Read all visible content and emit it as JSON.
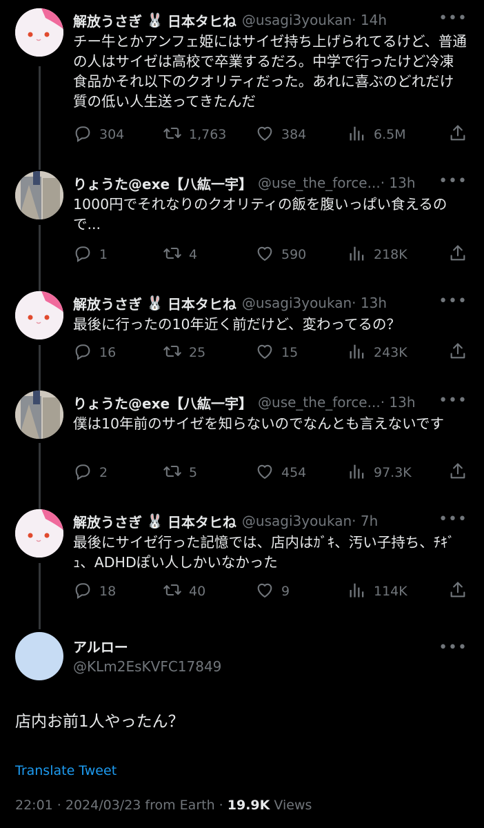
{
  "replies": [
    {
      "display_name": "解放うさぎ",
      "emoji": "🐰",
      "name_suffix": "日本タヒね",
      "handle": "@usagi3youkan",
      "time": "· 14h",
      "avatar": "rabbit",
      "text": "チー牛とかアンフェ姫にはサイゼ持ち上げられてるけど、普通の人はサイゼは高校で卒業するだろ。中学で行ったけど冷凍食品かそれ以下のクオリティだった。あれに喜ぶのどれだけ質の低い人生送ってきたんだ",
      "replies": "304",
      "retweets": "1,763",
      "likes": "384",
      "views": "6.5M"
    },
    {
      "display_name": "りょうた@exe【八紘一宇】",
      "emoji": "",
      "name_suffix": "",
      "handle": "@use_the_force...",
      "time": "· 13h",
      "avatar": "person",
      "text": "1000円でそれなりのクオリティの飯を腹いっぱい食えるので...",
      "replies": "1",
      "retweets": "4",
      "likes": "590",
      "views": "218K"
    },
    {
      "display_name": "解放うさぎ",
      "emoji": "🐰",
      "name_suffix": "日本タヒね",
      "handle": "@usagi3youkan",
      "time": "· 13h",
      "avatar": "rabbit",
      "text": "最後に行ったの10年近く前だけど、変わってるの？",
      "replies": "16",
      "retweets": "25",
      "likes": "15",
      "views": "243K"
    },
    {
      "display_name": "りょうた@exe【八紘一宇】",
      "emoji": "",
      "name_suffix": "",
      "handle": "@use_the_force...",
      "time": "· 13h",
      "avatar": "person",
      "text": "僕は10年前のサイゼを知らないのでなんとも言えないです",
      "replies": "2",
      "retweets": "5",
      "likes": "454",
      "views": "97.3K"
    },
    {
      "display_name": "解放うさぎ",
      "emoji": "🐰",
      "name_suffix": "日本タヒね",
      "handle": "@usagi3youkan",
      "time": "· 7h",
      "avatar": "rabbit",
      "text": "最後にサイゼ行った記憶では、店内はｶﾞｷ、汚い子持ち、ﾁｷﾞｭ、ADHDぽい人しかいなかった",
      "replies": "18",
      "retweets": "40",
      "likes": "9",
      "views": "114K"
    }
  ],
  "main": {
    "display_name": "アルロー",
    "handle": "@KLm2EsKVFC17849",
    "text": "店内お前1人やったん？",
    "translate_label": "Translate Tweet",
    "timestamp": "22:01 · 2024/03/23 from Earth ·",
    "views_count": "19.9K",
    "views_label": "Views"
  },
  "icons": {
    "more": "more-icon",
    "reply": "reply-icon",
    "retweet": "retweet-icon",
    "like": "heart-icon",
    "views": "views-icon",
    "share": "share-icon"
  },
  "colors": {
    "background": "#000000",
    "text": "#e7e9ea",
    "muted": "#71767b",
    "link": "#1d9bf0"
  }
}
